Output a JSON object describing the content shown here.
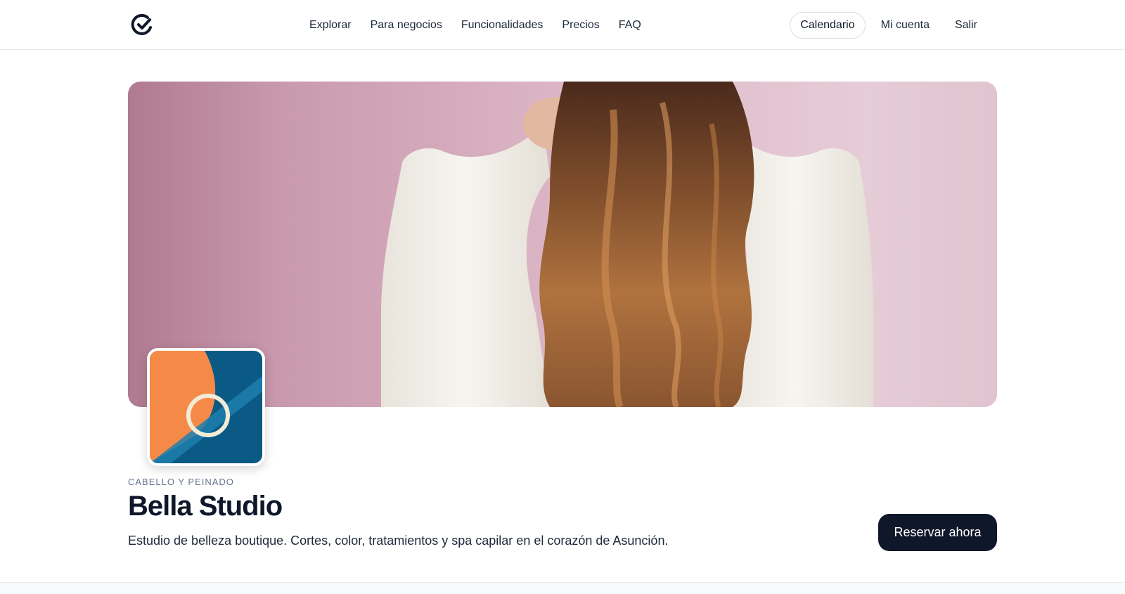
{
  "nav": {
    "logo_icon": "check-circle-logo-icon",
    "links": [
      "Explorar",
      "Para negocios",
      "Funcionalidades",
      "Precios",
      "FAQ"
    ],
    "calendar_label": "Calendario",
    "account_label": "Mi cuenta",
    "logout_label": "Salir"
  },
  "hero": {
    "image_subject": "woman with long wavy hair from behind, hands in hair, pink background"
  },
  "business": {
    "logo_colors": [
      "#f58a48",
      "#0b5a86",
      "#f1ecd8"
    ],
    "category": "CABELLO Y PEINADO",
    "name": "Bella Studio",
    "description": "Estudio de belleza boutique. Cortes, color, tratamientos y spa capilar en el corazón de Asunción.",
    "book_label": "Reservar ahora"
  },
  "colors": {
    "primary": "#0f172a",
    "hero_bg": "#dcb6c6",
    "border": "#e6e8ec"
  }
}
